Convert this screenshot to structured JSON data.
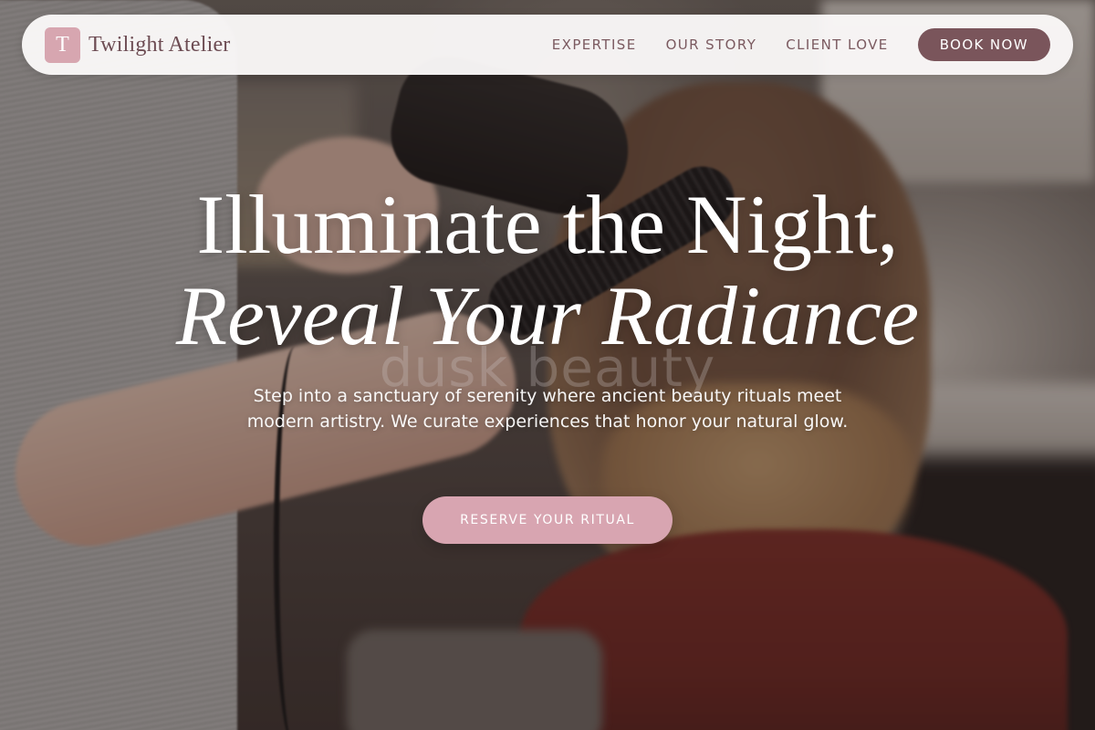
{
  "colors": {
    "nav_background": "#faf8f8",
    "brand_mark": "#d7a6b0",
    "brand_text": "#6d4c53",
    "nav_link": "#7b5a60",
    "book_button": "#7a555b",
    "cta_button": "#d8a5b1"
  },
  "header": {
    "brand": {
      "mark": "T",
      "name": "Twilight Atelier"
    },
    "nav_links": [
      "EXPERTISE",
      "OUR STORY",
      "CLIENT LOVE"
    ],
    "book_label": "BOOK NOW"
  },
  "hero": {
    "headline_line1": "Illuminate the Night,",
    "headline_line2": "Reveal Your Radiance",
    "watermark": "dusk beauty",
    "subtext": "Step into a sanctuary of serenity where ancient beauty rituals meet modern artistry. We curate experiences that honor your natural glow.",
    "cta_label": "RESERVE YOUR RITUAL"
  },
  "icons": {
    "brand_mark": "letter-t-monogram-icon"
  }
}
